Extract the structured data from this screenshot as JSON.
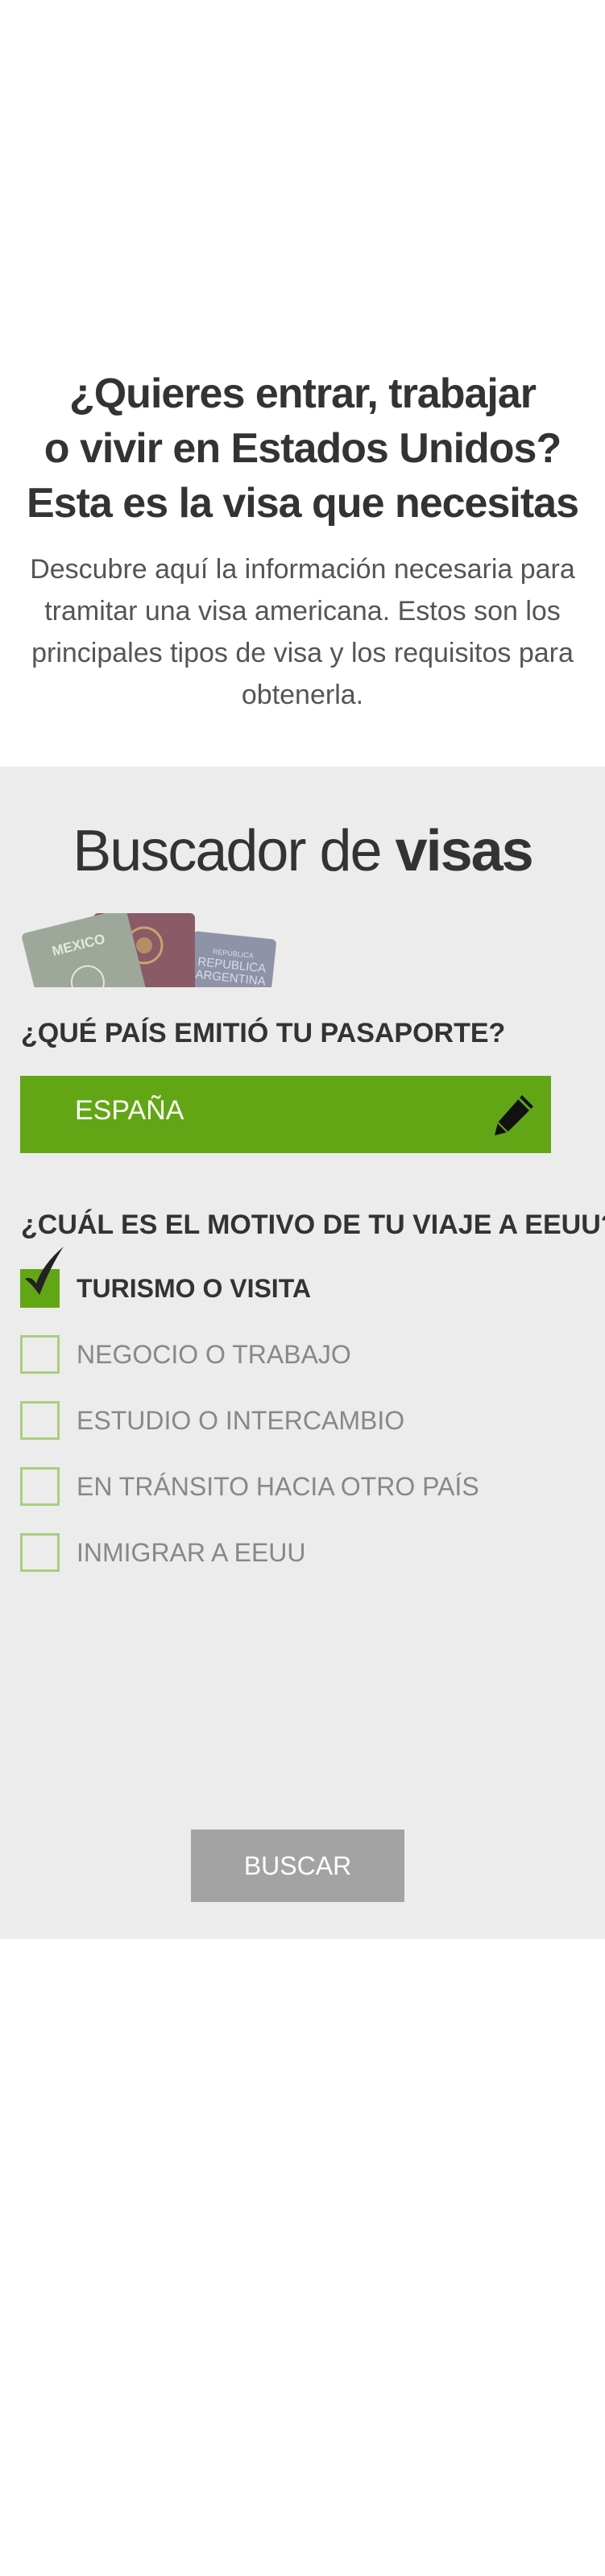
{
  "hero": {
    "title_lines": [
      "¿Quieres entrar, trabajar",
      "o vivir en Estados Unidos?",
      "Esta es la visa que necesitas"
    ],
    "description": "Descubre aquí la información necesaria para tramitar una visa americana. Estos son los principales tipos de visa y los requisitos para obtenerla."
  },
  "finder": {
    "title_light": "Buscador de ",
    "title_bold": "visas",
    "passports": [
      "MEXICO",
      "REPUBLICA ARGENTINA"
    ],
    "country_question": "¿QUÉ PAÍS EMITIÓ TU PASAPORTE?",
    "country_value": "ESPAÑA",
    "reason_question": "¿CUÁL ES EL MOTIVO DE TU VIAJE A EEUU?",
    "options": [
      {
        "label": "TURISMO O VISITA",
        "checked": true
      },
      {
        "label": "NEGOCIO O TRABAJO",
        "checked": false
      },
      {
        "label": "ESTUDIO O INTERCAMBIO",
        "checked": false
      },
      {
        "label": "EN TRÁNSITO HACIA OTRO PAÍS",
        "checked": false
      },
      {
        "label": "INMIGRAR A EEUU",
        "checked": false
      }
    ],
    "search_label": "BUSCAR"
  },
  "colors": {
    "accent_green": "#63a615",
    "checkbox_border": "#a9cf7f",
    "panel_bg": "#ececec",
    "button_grey": "#a3a3a3"
  },
  "icons": {
    "edit": "pencil-icon",
    "selected": "checkmark-icon",
    "passport": "passport-icon"
  }
}
